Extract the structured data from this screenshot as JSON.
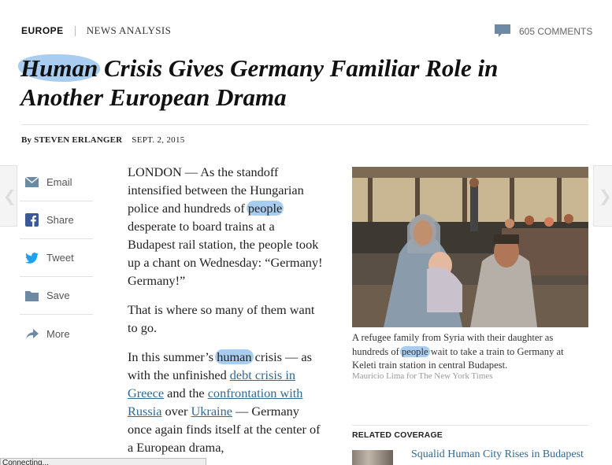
{
  "kicker": {
    "section": "EUROPE",
    "label": "NEWS ANALYSIS"
  },
  "comments": {
    "count": "605 COMMENTS",
    "icon": "comment-bubble-icon"
  },
  "headline": {
    "highlight": "Human",
    "rest": " Crisis Gives Germany Familiar Role in Another European Drama"
  },
  "byline": {
    "author": "By STEVEN ERLANGER",
    "date": "SEPT. 2, 2015"
  },
  "share": [
    {
      "label": "Email",
      "icon": "envelope-icon"
    },
    {
      "label": "Share",
      "icon": "facebook-icon"
    },
    {
      "label": "Tweet",
      "icon": "twitter-bird-icon"
    },
    {
      "label": "Save",
      "icon": "folder-icon"
    },
    {
      "label": "More",
      "icon": "share-arrow-icon"
    }
  ],
  "story": {
    "p1": {
      "before": "LONDON — As the standoff intensified between the Hungarian police and hundreds of ",
      "highlight": "people",
      "after": " desperate to board trains at a Budapest rail station, the people took up a chant on Wednesday: “Germany! Germany!”"
    },
    "p2": "That is where so many of them want to go.",
    "p3": {
      "start": "In this summer’s ",
      "highlight": "human",
      "mid1": " crisis — as with the unfinished ",
      "link1": "debt crisis in Greece",
      "mid2": " and the ",
      "link2": "confrontation with Russia",
      "mid3": " over ",
      "link3": "Ukraine",
      "end": " — Germany once again finds itself at the center of a European drama,"
    }
  },
  "photo": {
    "caption_before": "A refugee family from Syria with their daughter as hundreds of ",
    "caption_highlight": "people",
    "caption_after": " wait to take a train to Germany at Keleti train station in central Budapest.",
    "credit": "Mauricio Lima for The New York Times"
  },
  "related": {
    "heading": "RELATED COVERAGE",
    "title": "Squalid Human City Rises in Budapest"
  },
  "status_bar": "Connecting...",
  "colors": {
    "link": "#326891",
    "highlight": "#a9cdf0",
    "twitter": "#1da1f2",
    "facebook": "#3b5998",
    "icon_gray": "#6d8aa5"
  }
}
